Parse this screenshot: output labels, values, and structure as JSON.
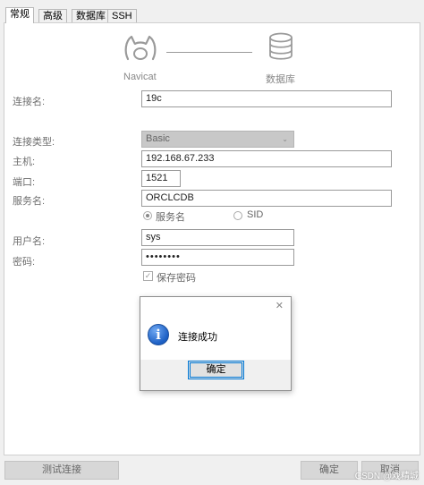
{
  "tabs": [
    {
      "label": "常规",
      "active": true
    },
    {
      "label": "高级",
      "active": false
    },
    {
      "label": "数据库",
      "active": false
    },
    {
      "label": "SSH",
      "active": false
    }
  ],
  "diagram": {
    "left_label": "Navicat",
    "right_label": "数据库",
    "left_icon": "navicat-logo-icon",
    "right_icon": "database-icon"
  },
  "form": {
    "connection_name_label": "连接名:",
    "connection_name_value": "19c",
    "connection_type_label": "连接类型:",
    "connection_type_value": "Basic",
    "host_label": "主机:",
    "host_value": "192.168.67.233",
    "port_label": "端口:",
    "port_value": "1521",
    "service_name_label": "服务名:",
    "service_name_value": "ORCLCDB",
    "radio_service_name": "服务名",
    "radio_sid": "SID",
    "username_label": "用户名:",
    "username_value": "sys",
    "password_label": "密码:",
    "password_value": "••••••••",
    "save_password_label": "保存密码"
  },
  "dialog": {
    "message": "连接成功",
    "ok_label": "确定",
    "close_glyph": "✕"
  },
  "footer": {
    "test_connection_label": "测试连接",
    "ok_label": "确定",
    "cancel_label": "取消"
  },
  "watermark": "CSDN @戏精城",
  "colors": {
    "accent": "#0078d7",
    "info_icon": "#1c5fc4"
  }
}
